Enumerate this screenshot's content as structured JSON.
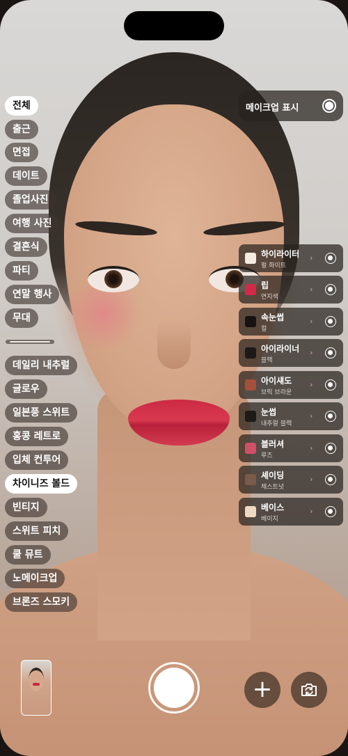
{
  "categories": [
    {
      "label": "전체",
      "active": true
    },
    {
      "label": "출근",
      "active": false
    },
    {
      "label": "면접",
      "active": false
    },
    {
      "label": "데이트",
      "active": false
    },
    {
      "label": "졸업사진",
      "active": false
    },
    {
      "label": "여행 사진",
      "active": false
    },
    {
      "label": "결혼식",
      "active": false
    },
    {
      "label": "파티",
      "active": false
    },
    {
      "label": "연말 행사",
      "active": false
    },
    {
      "label": "무대",
      "active": false
    }
  ],
  "styles": [
    {
      "label": "데일리 내추럴",
      "active": false
    },
    {
      "label": "글로우",
      "active": false
    },
    {
      "label": "일본풍 스위트",
      "active": false
    },
    {
      "label": "홍콩 레트로",
      "active": false
    },
    {
      "label": "입체 컨투어",
      "active": false
    },
    {
      "label": "차이니즈 볼드",
      "active": true
    },
    {
      "label": "빈티지",
      "active": false
    },
    {
      "label": "스위트 피치",
      "active": false
    },
    {
      "label": "쿨 뮤트",
      "active": false
    },
    {
      "label": "노메이크업",
      "active": false
    },
    {
      "label": "브론즈 스모키",
      "active": false
    }
  ],
  "makeup_toggle": {
    "label": "메이크업 표시",
    "on": true
  },
  "makeup_items": [
    {
      "name": "하이라이터",
      "sub": "펄 화이트",
      "color": "#f5ecdf"
    },
    {
      "name": "립",
      "sub": "연지색",
      "color": "#d12a47"
    },
    {
      "name": "속눈썹",
      "sub": "컬",
      "color": "#161311"
    },
    {
      "name": "아이라이너",
      "sub": "블랙",
      "color": "#1c1917"
    },
    {
      "name": "아이섀도",
      "sub": "브릭 브라운",
      "color": "#a4503a"
    },
    {
      "name": "눈썹",
      "sub": "내추럴 블랙",
      "color": "#1d1a18"
    },
    {
      "name": "블러셔",
      "sub": "루즈",
      "color": "#cf4f68"
    },
    {
      "name": "셰이딩",
      "sub": "체스트넛",
      "color": "#7a5a4a"
    },
    {
      "name": "베이스",
      "sub": "베이지",
      "color": "#eed8c2"
    }
  ],
  "chevron_glyph": "›",
  "add_glyph": "+"
}
